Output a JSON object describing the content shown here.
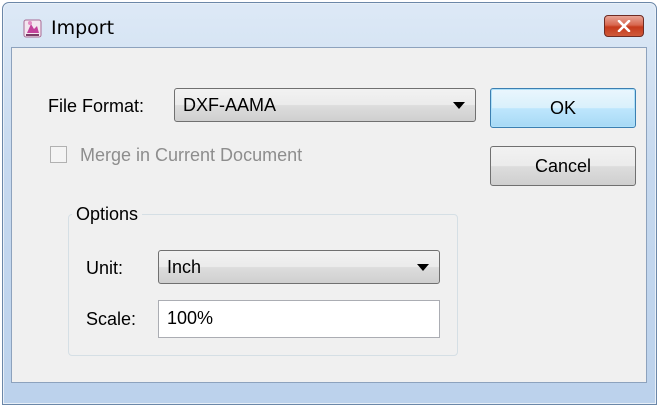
{
  "window": {
    "title": "Import",
    "close_icon": "close-x-icon"
  },
  "form": {
    "file_format_label": "File Format:",
    "file_format_value": "DXF-AAMA",
    "merge_label": "Merge in Current Document",
    "merge_checked": false,
    "merge_enabled": false
  },
  "buttons": {
    "ok": "OK",
    "cancel": "Cancel"
  },
  "options": {
    "title": "Options",
    "unit_label": "Unit:",
    "unit_value": "Inch",
    "scale_label": "Scale:",
    "scale_value": "100%"
  },
  "colors": {
    "title_bar": "#c6d9ef",
    "close_button": "#c53a1c",
    "dialog_body": "#f0f0f0",
    "default_button_border": "#3c7fb1"
  }
}
